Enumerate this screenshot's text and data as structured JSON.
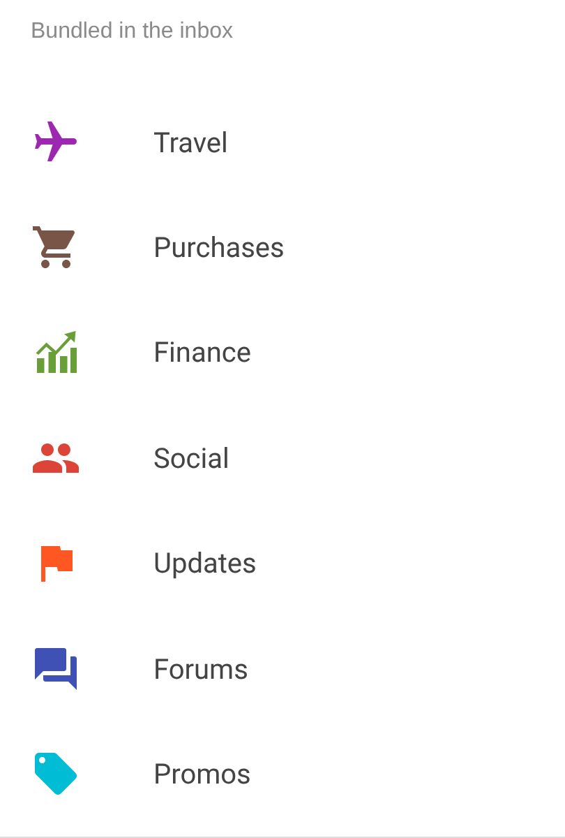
{
  "header": "Bundled in the inbox",
  "items": [
    {
      "label": "Travel",
      "color": "#9c27b0"
    },
    {
      "label": "Purchases",
      "color": "#795548"
    },
    {
      "label": "Finance",
      "color": "#689f38"
    },
    {
      "label": "Social",
      "color": "#db4437"
    },
    {
      "label": "Updates",
      "color": "#ff5722"
    },
    {
      "label": "Forums",
      "color": "#3f51b5"
    },
    {
      "label": "Promos",
      "color": "#00bcd4"
    }
  ]
}
